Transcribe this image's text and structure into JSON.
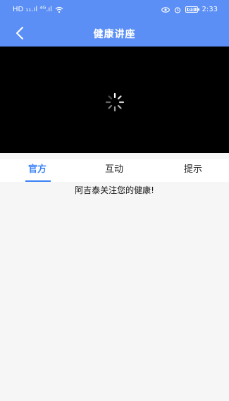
{
  "status_bar": {
    "left_text": "HD ₁₁.ıl ⁴ᴳ.ıl",
    "time": "2:33",
    "battery": "86"
  },
  "header": {
    "title": "健康讲座",
    "back_icon": "chevron-left-icon",
    "color": "#5b8ff5"
  },
  "video": {
    "state_icon": "loading-spinner-icon"
  },
  "tabs": [
    {
      "label": "官方",
      "active": true
    },
    {
      "label": "互动",
      "active": false
    },
    {
      "label": "提示",
      "active": false
    }
  ],
  "content": {
    "notice": "阿吉泰关注您的健康!"
  },
  "colors": {
    "accent": "#3b82f6",
    "header_bg": "#5b8ff5",
    "video_bg": "#000000"
  }
}
